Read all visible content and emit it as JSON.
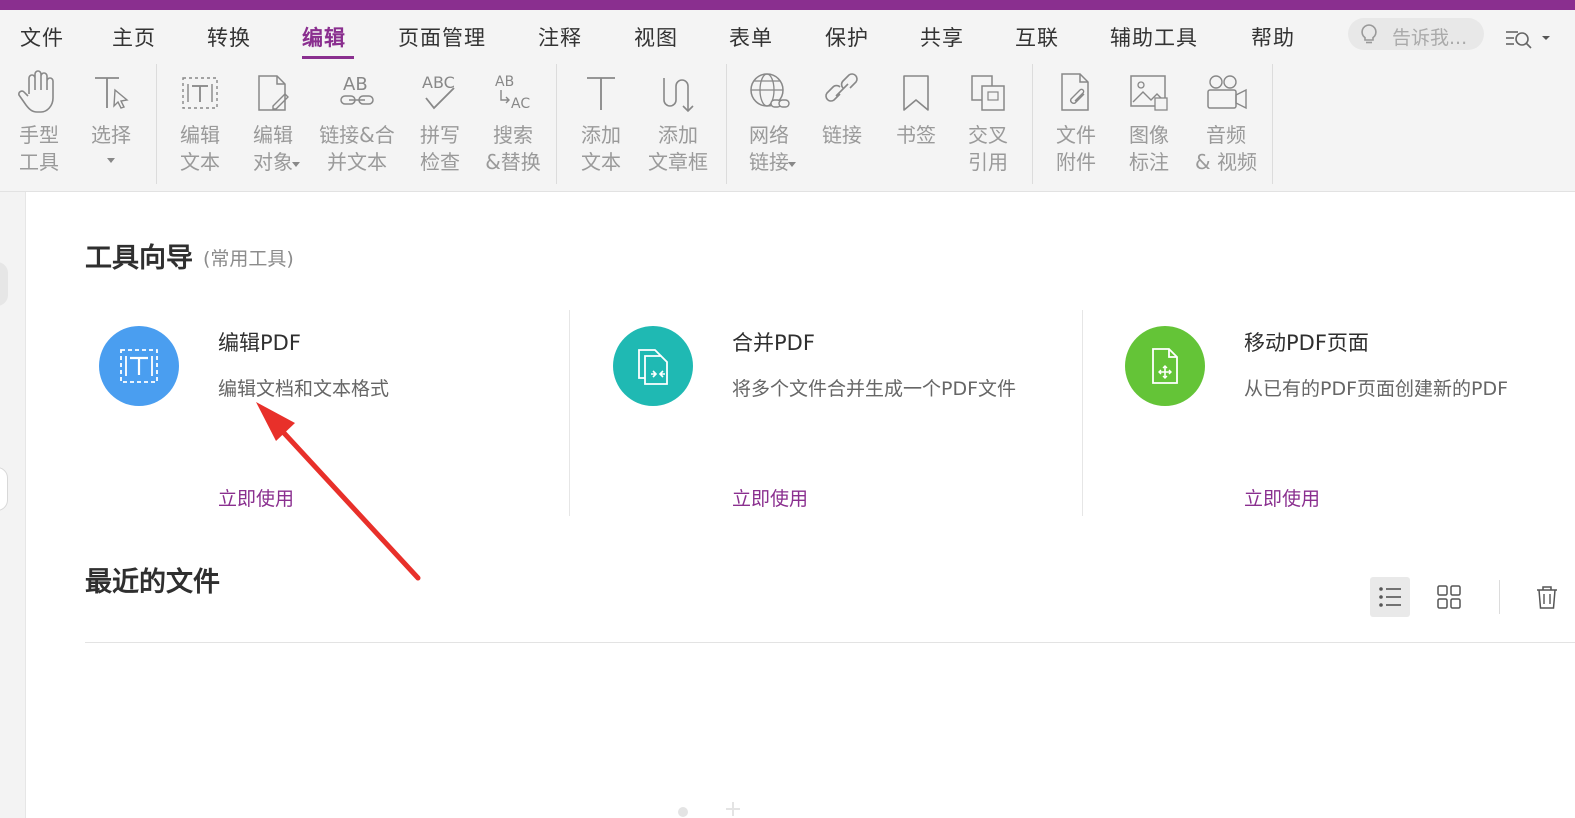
{
  "colors": {
    "brand": "#8a2f8f",
    "edit_pdf_icon": "#4a9ef0",
    "merge_pdf_icon": "#1fb9b3",
    "move_pages_icon": "#64c437",
    "annotation_arrow": "#e8302a"
  },
  "menu": {
    "items": [
      "文件",
      "主页",
      "转换",
      "编辑",
      "页面管理",
      "注释",
      "视图",
      "表单",
      "保护",
      "共享",
      "互联",
      "辅助工具",
      "帮助"
    ],
    "active": "编辑",
    "tellme_placeholder": "告诉我..."
  },
  "ribbon": {
    "tools": [
      {
        "label": "手型\n工具",
        "icon": "hand-icon"
      },
      {
        "label": "选择",
        "icon": "select-cursor-icon",
        "has_dropdown": true
      },
      {
        "label": "编辑\n文本",
        "icon": "edit-text-icon"
      },
      {
        "label": "编辑\n对象",
        "icon": "edit-object-icon",
        "has_dropdown": true
      },
      {
        "label": "链接&合\n并文本",
        "icon": "link-join-text-icon"
      },
      {
        "label": "拼写\n检查",
        "icon": "spell-check-icon"
      },
      {
        "label": "搜索\n&替换",
        "icon": "search-replace-icon"
      },
      {
        "label": "添加\n文本",
        "icon": "add-text-icon"
      },
      {
        "label": "添加\n文章框",
        "icon": "add-article-box-icon"
      },
      {
        "label": "网络\n链接",
        "icon": "web-link-icon",
        "has_dropdown": true
      },
      {
        "label": "链接",
        "icon": "link-icon"
      },
      {
        "label": "书签",
        "icon": "bookmark-icon"
      },
      {
        "label": "交叉\n引用",
        "icon": "cross-reference-icon"
      },
      {
        "label": "文件\n附件",
        "icon": "file-attachment-icon"
      },
      {
        "label": "图像\n标注",
        "icon": "image-annotation-icon"
      },
      {
        "label": "音频\n& 视频",
        "icon": "audio-video-icon"
      }
    ]
  },
  "tool_guide": {
    "title": "工具向导",
    "subtitle": "(常用工具)",
    "cards": [
      {
        "title": "编辑PDF",
        "desc": "编辑文档和文本格式",
        "action": "立即使用",
        "icon": "edit-pdf-icon"
      },
      {
        "title": "合并PDF",
        "desc": "将多个文件合并生成一个PDF文件",
        "action": "立即使用",
        "icon": "merge-pdf-icon"
      },
      {
        "title": "移动PDF页面",
        "desc": "从已有的PDF页面创建新的PDF",
        "action": "立即使用",
        "icon": "move-pages-icon"
      }
    ]
  },
  "recent_files": {
    "title": "最近的文件",
    "view_mode": "list"
  }
}
